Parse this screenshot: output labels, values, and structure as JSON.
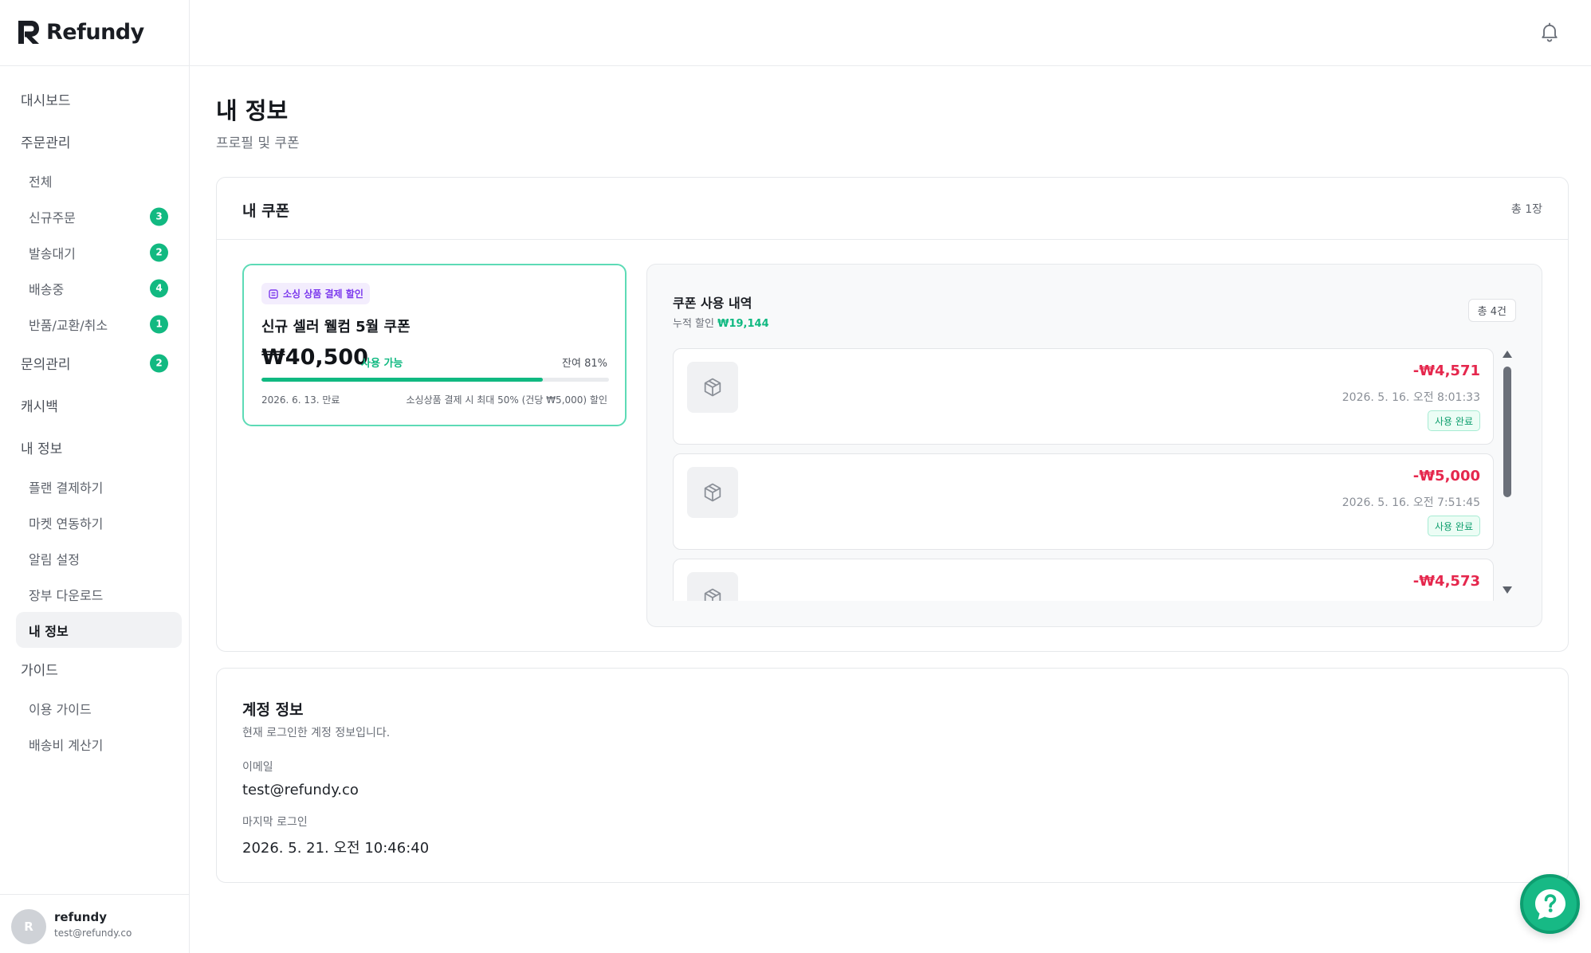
{
  "app": {
    "name": "Refundy"
  },
  "sidebar": {
    "items": [
      {
        "label": "대시보드",
        "type": "top"
      },
      {
        "label": "주문관리",
        "type": "top"
      },
      {
        "label": "전체",
        "type": "sub"
      },
      {
        "label": "신규주문",
        "type": "sub",
        "badge": "3"
      },
      {
        "label": "발송대기",
        "type": "sub",
        "badge": "2"
      },
      {
        "label": "배송중",
        "type": "sub",
        "badge": "4"
      },
      {
        "label": "반품/교환/취소",
        "type": "sub",
        "badge": "1"
      },
      {
        "label": "문의관리",
        "type": "top",
        "badge": "2"
      },
      {
        "label": "캐시백",
        "type": "top"
      },
      {
        "label": "내 정보",
        "type": "top"
      },
      {
        "label": "플랜 결제하기",
        "type": "sub"
      },
      {
        "label": "마켓 연동하기",
        "type": "sub"
      },
      {
        "label": "알림 설정",
        "type": "sub"
      },
      {
        "label": "장부 다운로드",
        "type": "sub"
      },
      {
        "label": "내 정보",
        "type": "sub",
        "active": true
      },
      {
        "label": "가이드",
        "type": "top"
      },
      {
        "label": "이용 가이드",
        "type": "sub"
      },
      {
        "label": "배송비 계산기",
        "type": "sub"
      }
    ],
    "user": {
      "initial": "R",
      "name": "refundy",
      "email": "test@refundy.co"
    }
  },
  "header": {
    "bell_icon": "bell-icon"
  },
  "page": {
    "title": "내 정보",
    "subtitle": "프로필 및 쿠폰"
  },
  "coupons": {
    "title": "내 쿠폰",
    "count": "총 1장",
    "coupon": {
      "tag": "소싱 상품 결제 할인",
      "name": "신규 셀러 웰컴 5월 쿠폰",
      "amount": "₩40,500",
      "status": "사용 가능",
      "remain": "잔여 81%",
      "remain_fraction": 0.81,
      "expire": "2026. 6. 13. 만료",
      "desc": "소싱상품 결제 시 최대 50% (건당 ₩5,000) 할인"
    },
    "history": {
      "title": "쿠폰 사용 내역",
      "sub_label": "누적 할인",
      "sub_amount": "₩19,144",
      "count": "총 4건",
      "rows": [
        {
          "amount": "-₩4,571",
          "date": "2026. 5. 16. 오전 8:01:33",
          "badge": "사용 완료"
        },
        {
          "amount": "-₩5,000",
          "date": "2026. 5. 16. 오전 7:51:45",
          "badge": "사용 완료"
        },
        {
          "amount": "-₩4,573",
          "date": "",
          "badge": ""
        }
      ]
    }
  },
  "account": {
    "title": "계정 정보",
    "subtitle": "현재 로그인한 계정 정보입니다.",
    "email_label": "이메일",
    "email": "test@refundy.co",
    "last_login_label": "마지막 로그인",
    "last_login": "2026. 5. 21. 오전 10:46:40"
  },
  "colors": {
    "accent": "#10b981",
    "negative": "#e5274d",
    "tag": "#7c3aed"
  }
}
